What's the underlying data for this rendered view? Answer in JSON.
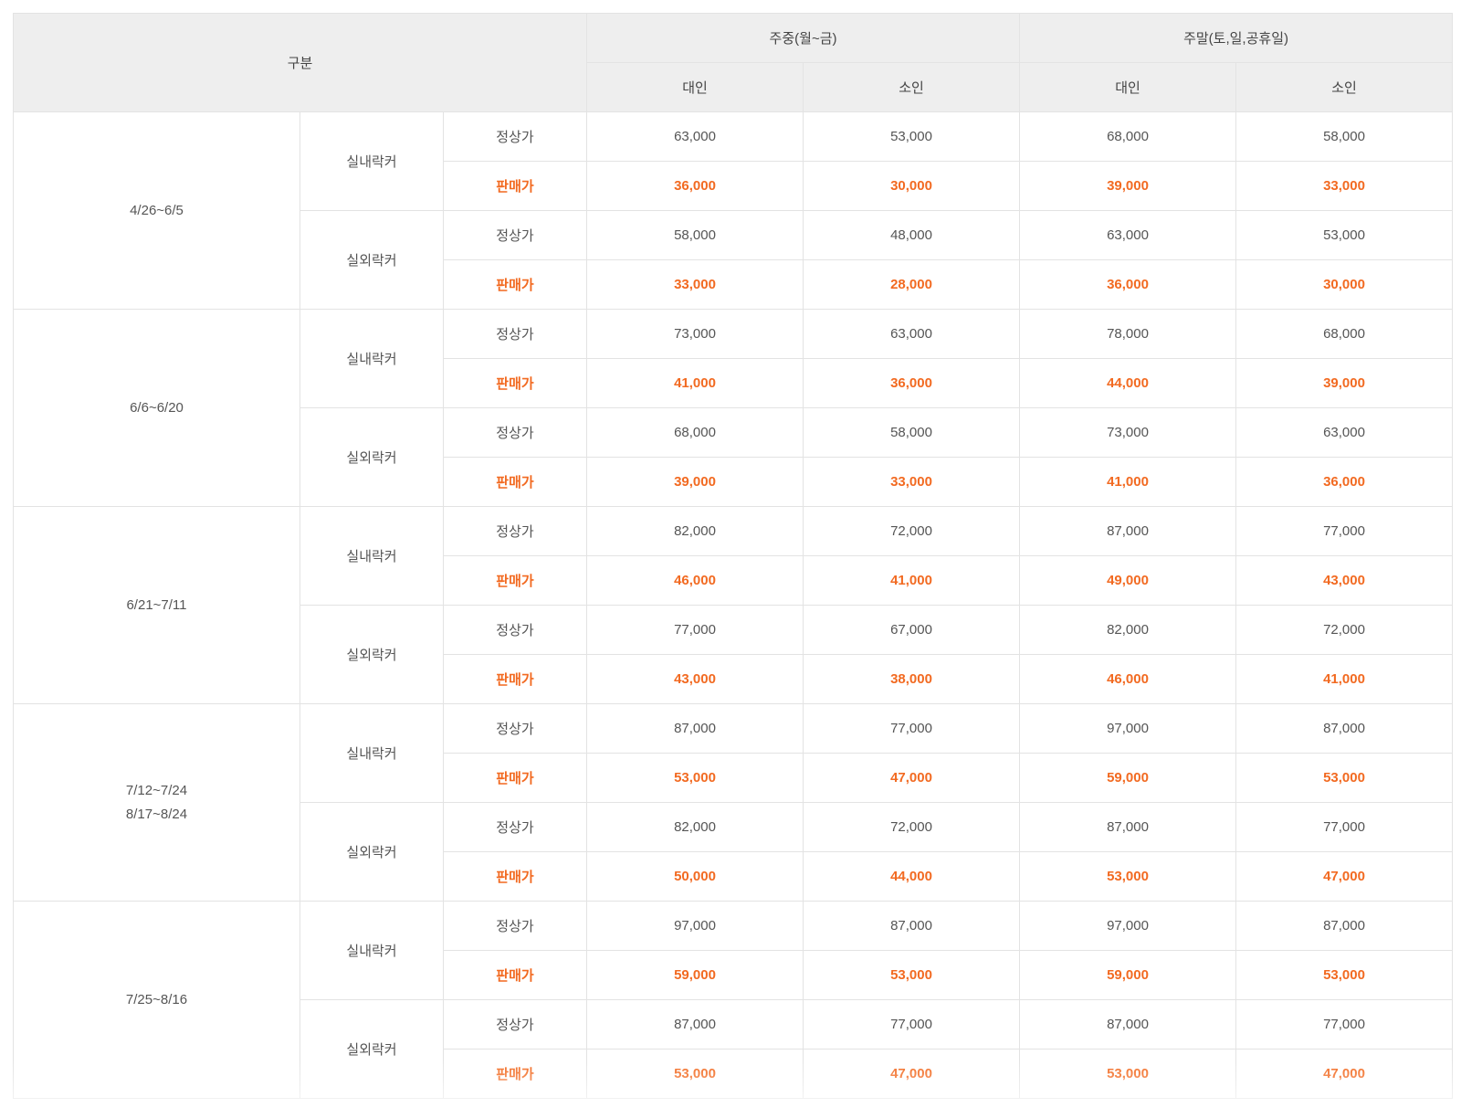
{
  "header": {
    "category": "구분",
    "weekday": "주중(월~금)",
    "weekend": "주말(토,일,공휴일)",
    "adult": "대인",
    "child": "소인"
  },
  "labels": {
    "indoor": "실내락커",
    "outdoor": "실외락커",
    "regular": "정상가",
    "sale": "판매가"
  },
  "periods": [
    {
      "lines": [
        "4/26~6/5"
      ],
      "indoor": {
        "regular": [
          "63,000",
          "53,000",
          "68,000",
          "58,000"
        ],
        "sale": [
          "36,000",
          "30,000",
          "39,000",
          "33,000"
        ]
      },
      "outdoor": {
        "regular": [
          "58,000",
          "48,000",
          "63,000",
          "53,000"
        ],
        "sale": [
          "33,000",
          "28,000",
          "36,000",
          "30,000"
        ]
      }
    },
    {
      "lines": [
        "6/6~6/20"
      ],
      "indoor": {
        "regular": [
          "73,000",
          "63,000",
          "78,000",
          "68,000"
        ],
        "sale": [
          "41,000",
          "36,000",
          "44,000",
          "39,000"
        ]
      },
      "outdoor": {
        "regular": [
          "68,000",
          "58,000",
          "73,000",
          "63,000"
        ],
        "sale": [
          "39,000",
          "33,000",
          "41,000",
          "36,000"
        ]
      }
    },
    {
      "lines": [
        "6/21~7/11"
      ],
      "indoor": {
        "regular": [
          "82,000",
          "72,000",
          "87,000",
          "77,000"
        ],
        "sale": [
          "46,000",
          "41,000",
          "49,000",
          "43,000"
        ]
      },
      "outdoor": {
        "regular": [
          "77,000",
          "67,000",
          "82,000",
          "72,000"
        ],
        "sale": [
          "43,000",
          "38,000",
          "46,000",
          "41,000"
        ]
      }
    },
    {
      "lines": [
        "7/12~7/24",
        "8/17~8/24"
      ],
      "indoor": {
        "regular": [
          "87,000",
          "77,000",
          "97,000",
          "87,000"
        ],
        "sale": [
          "53,000",
          "47,000",
          "59,000",
          "53,000"
        ]
      },
      "outdoor": {
        "regular": [
          "82,000",
          "72,000",
          "87,000",
          "77,000"
        ],
        "sale": [
          "50,000",
          "44,000",
          "53,000",
          "47,000"
        ]
      }
    },
    {
      "lines": [
        "7/25~8/16"
      ],
      "indoor": {
        "regular": [
          "97,000",
          "87,000",
          "97,000",
          "87,000"
        ],
        "sale": [
          "59,000",
          "53,000",
          "59,000",
          "53,000"
        ]
      },
      "outdoor": {
        "regular": [
          "87,000",
          "77,000",
          "87,000",
          "77,000"
        ],
        "sale": [
          "53,000",
          "47,000",
          "53,000",
          "47,000"
        ]
      }
    }
  ],
  "colors": {
    "header_bg": "#eeeeee",
    "border": "#e3e3e3",
    "text": "#555555",
    "sale_accent": "#f26a21"
  }
}
